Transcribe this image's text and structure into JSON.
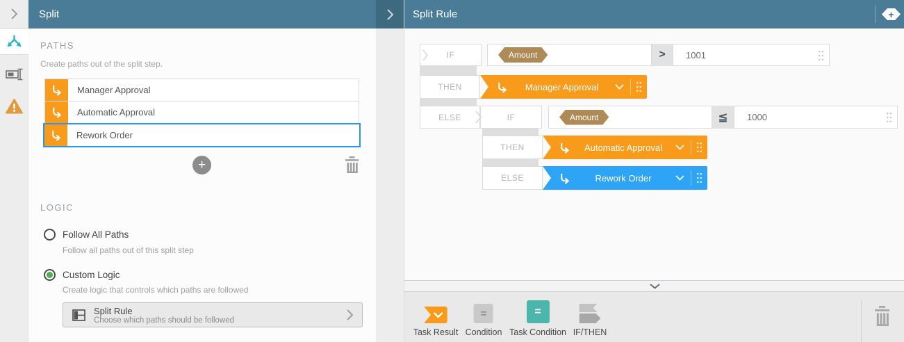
{
  "left_panel": {
    "title": "Split",
    "paths": {
      "heading": "PATHS",
      "description": "Create paths out of the split step.",
      "items": [
        {
          "label": "Manager Approval",
          "selected": false
        },
        {
          "label": "Automatic Approval",
          "selected": false
        },
        {
          "label": "Rework Order",
          "selected": true
        }
      ]
    },
    "logic": {
      "heading": "LOGIC",
      "options": [
        {
          "label": "Follow All Paths",
          "description": "Follow all paths out of this split step",
          "selected": false
        },
        {
          "label": "Custom Logic",
          "description": "Create logic that controls which paths are followed",
          "selected": true
        }
      ],
      "rule_card": {
        "title": "Split Rule",
        "subtitle": "Choose which paths should be followed"
      }
    }
  },
  "right_panel": {
    "title": "Split Rule",
    "rule": {
      "row1": {
        "keyword": "IF",
        "field": "Amount",
        "operator": ">",
        "value": "1001"
      },
      "row2": {
        "keyword": "THEN",
        "path": "Manager Approval"
      },
      "row3": {
        "keyword_else": "ELSE",
        "keyword_if": "IF",
        "field": "Amount",
        "operator": "≦",
        "value": "1000"
      },
      "row4": {
        "keyword": "THEN",
        "path": "Automatic Approval"
      },
      "row5": {
        "keyword": "ELSE",
        "path": "Rework Order"
      }
    },
    "toolbar": {
      "items": [
        {
          "label": "Task Result"
        },
        {
          "label": "Condition"
        },
        {
          "label": "Task Condition"
        },
        {
          "label": "IF/THEN"
        }
      ]
    }
  },
  "colors": {
    "header_teal": "#4a7c98",
    "header_dark_teal": "#3e6a80",
    "path_orange": "#f89b1b",
    "block_blue": "#2da4f5",
    "field_chip_tan": "#ae8a57",
    "selected_border_blue": "#2795f3",
    "radio_green": "#4caf50",
    "split_icon_teal": "#29b6c8",
    "task_condition_teal": "#4db6ac",
    "warning_orange": "#e09c3c"
  }
}
